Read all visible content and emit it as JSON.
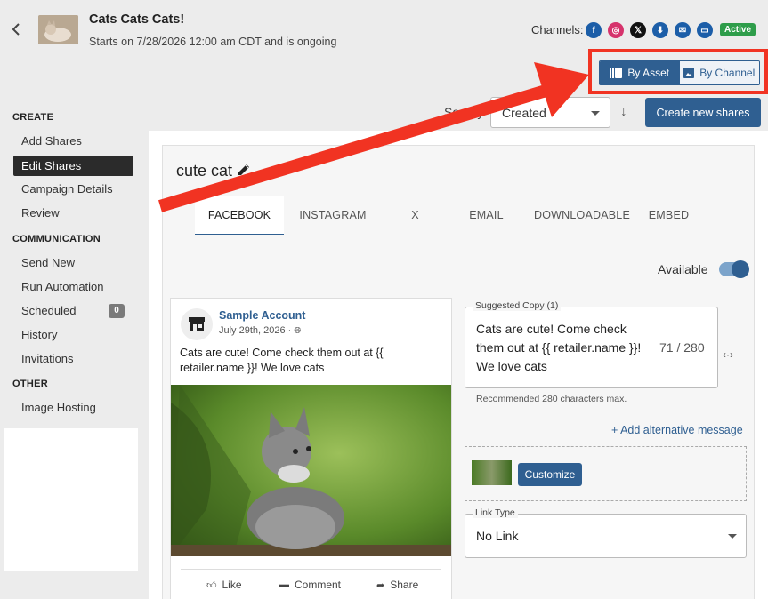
{
  "header": {
    "title": "Cats Cats Cats!",
    "subtitle": "Starts on 7/28/2026 12:00 am CDT and is ongoing",
    "channels_label": "Channels:",
    "status": "Active",
    "view_toggle": {
      "by_asset": "By Asset",
      "by_channel": "By Channel"
    }
  },
  "channels": [
    {
      "name": "facebook-icon",
      "glyph": "f",
      "color": "#1c5ea8"
    },
    {
      "name": "instagram-icon",
      "glyph": "◎",
      "color": "#d6336c"
    },
    {
      "name": "x-icon",
      "glyph": "𝕏",
      "color": "#111111"
    },
    {
      "name": "download-icon",
      "glyph": "⬇",
      "color": "#1c5ea8"
    },
    {
      "name": "email-icon",
      "glyph": "✉",
      "color": "#1c5ea8"
    },
    {
      "name": "embed-icon",
      "glyph": "▭",
      "color": "#1c5ea8"
    }
  ],
  "sidebar": {
    "create_heading": "CREATE",
    "create_items": [
      "Add Shares",
      "Edit Shares",
      "Campaign Details",
      "Review"
    ],
    "communication_heading": "COMMUNICATION",
    "communication_items": [
      "Send New",
      "Run Automation",
      "Scheduled",
      "History",
      "Invitations"
    ],
    "scheduled_count": "0",
    "other_heading": "OTHER",
    "other_items": [
      "Image Hosting"
    ]
  },
  "toolbar": {
    "sort_label": "Sort by",
    "sort_value": "Created",
    "create_button": "Create new shares"
  },
  "asset": {
    "title": "cute cat",
    "tabs": [
      "FACEBOOK",
      "INSTAGRAM",
      "X",
      "EMAIL",
      "DOWNLOADABLE",
      "EMBED"
    ],
    "available_label": "Available"
  },
  "preview": {
    "account": "Sample Account",
    "date": "July 29th, 2026 ·",
    "text": "Cats are cute! Come check them out at {{ retailer.name }}! We love cats",
    "actions": {
      "like": "Like",
      "comment": "Comment",
      "share": "Share"
    }
  },
  "copy": {
    "legend": "Suggested Copy (1)",
    "text": "Cats are cute! Come check them out at {{ retailer.name }}! We love cats",
    "count": "71 / 280",
    "recommendation": "Recommended 280 characters max.",
    "add_alternative": "+ Add alternative message",
    "customize_button": "Customize",
    "link_type_legend": "Link Type",
    "link_type_value": "No Link"
  },
  "colors": {
    "primary": "#2f5f91",
    "active_badge": "#2e9d4a",
    "highlight": "#f13322"
  }
}
